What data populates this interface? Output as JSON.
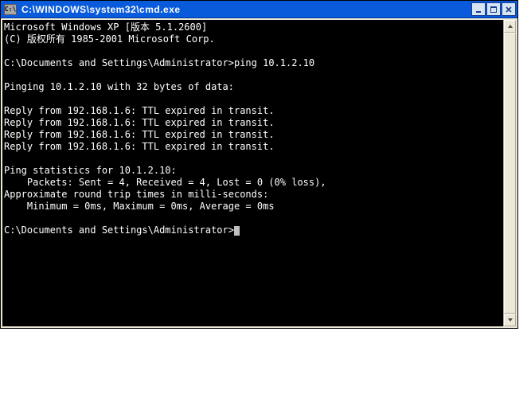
{
  "window": {
    "title": "C:\\WINDOWS\\system32\\cmd.exe",
    "icon_label": "C:\\",
    "controls": {
      "minimize": "minimize",
      "maximize": "maximize",
      "close": "close"
    }
  },
  "terminal": {
    "lines": [
      "Microsoft Windows XP [版本 5.1.2600]",
      "(C) 版权所有 1985-2001 Microsoft Corp.",
      "",
      "C:\\Documents and Settings\\Administrator>ping 10.1.2.10",
      "",
      "Pinging 10.1.2.10 with 32 bytes of data:",
      "",
      "Reply from 192.168.1.6: TTL expired in transit.",
      "Reply from 192.168.1.6: TTL expired in transit.",
      "Reply from 192.168.1.6: TTL expired in transit.",
      "Reply from 192.168.1.6: TTL expired in transit.",
      "",
      "Ping statistics for 10.1.2.10:",
      "    Packets: Sent = 4, Received = 4, Lost = 0 (0% loss),",
      "Approximate round trip times in milli-seconds:",
      "    Minimum = 0ms, Maximum = 0ms, Average = 0ms",
      ""
    ],
    "prompt": "C:\\Documents and Settings\\Administrator>"
  },
  "scrollbar": {
    "up": "scroll-up",
    "down": "scroll-down"
  }
}
